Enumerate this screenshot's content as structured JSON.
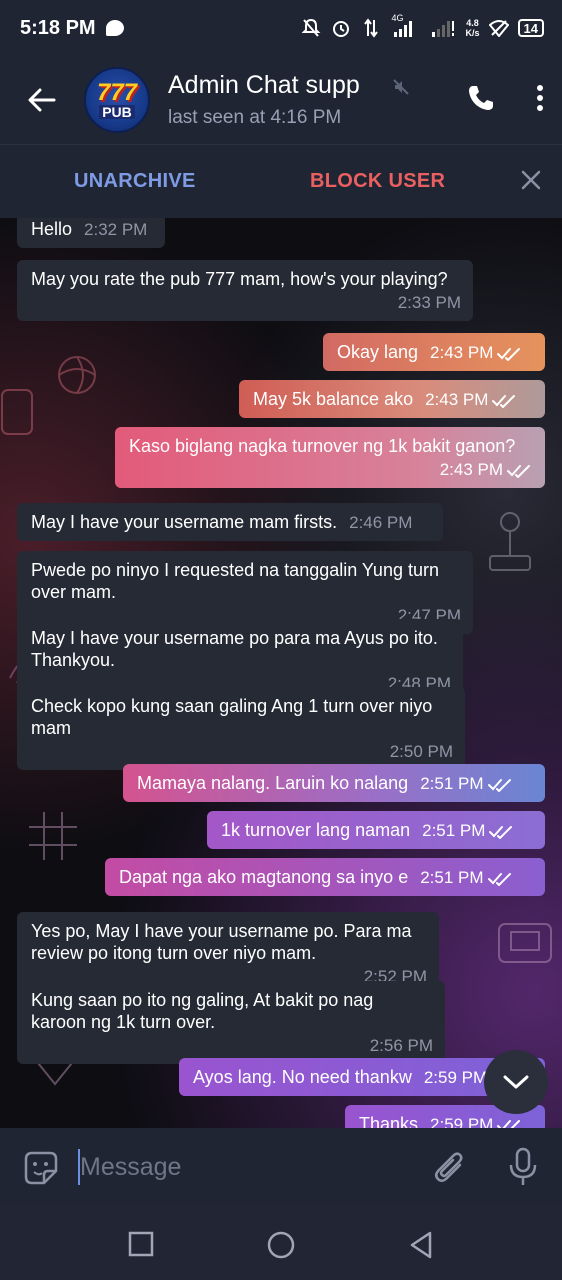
{
  "status_bar": {
    "time": "5:18 PM",
    "network_label": "4G",
    "speed_value": "4.8",
    "speed_unit": "K/s",
    "battery": "14"
  },
  "header": {
    "title": "Admin Chat supp",
    "subtitle": "last seen at 4:16 PM",
    "avatar": {
      "number": "777",
      "label": "PUB"
    }
  },
  "action_bar": {
    "unarchive_label": "UNARCHIVE",
    "block_label": "BLOCK USER"
  },
  "messages": [
    {
      "dir": "in",
      "text": "Hello",
      "time": "2:32 PM"
    },
    {
      "dir": "in",
      "text": "May you rate the pub 777 mam, how's your playing?",
      "time": "2:33 PM"
    },
    {
      "dir": "out",
      "text": "Okay lang",
      "time": "2:43 PM",
      "read": true
    },
    {
      "dir": "out",
      "text": "May 5k balance ako",
      "time": "2:43 PM",
      "read": true
    },
    {
      "dir": "out",
      "text": "Kaso biglang nagka turnover ng 1k bakit ganon?",
      "time": "2:43 PM",
      "read": true
    },
    {
      "dir": "in",
      "text": "May I have your username mam firsts.",
      "time": "2:46 PM"
    },
    {
      "dir": "in",
      "text": "Pwede po ninyo I requested na tanggalin Yung turn over mam.",
      "time": "2:47 PM"
    },
    {
      "dir": "in",
      "text": "May I have your username po para ma Ayus po ito. Thankyou.",
      "time": "2:48 PM"
    },
    {
      "dir": "in",
      "text": "Check kopo kung saan galing Ang 1 turn over niyo mam",
      "time": "2:50 PM"
    },
    {
      "dir": "out",
      "text": "Mamaya nalang. Laruin ko nalang",
      "time": "2:51 PM",
      "read": true
    },
    {
      "dir": "out",
      "text": "1k turnover lang naman",
      "time": "2:51 PM",
      "read": true
    },
    {
      "dir": "out",
      "text": "Dapat nga ako magtanong sa inyo e",
      "time": "2:51 PM",
      "read": true
    },
    {
      "dir": "in",
      "text": "Yes po, May I have your username po. Para ma review po itong turn over niyo mam.",
      "time": "2:52 PM"
    },
    {
      "dir": "in",
      "text": "Kung saan po ito ng galing, At bakit po nag karoon ng 1k turn over.",
      "time": "2:56 PM"
    },
    {
      "dir": "out",
      "text": "Ayos lang. No need thankw",
      "time": "2:59 PM",
      "read": true
    },
    {
      "dir": "out",
      "text": "Thanks",
      "time": "2:59 PM",
      "read": true
    }
  ],
  "input": {
    "placeholder": "Message"
  },
  "colors": {
    "header_bg": "#1f2533",
    "incoming_bubble": "#262a35",
    "unarchive": "#7f9be4",
    "block_user": "#ea6061"
  },
  "icons": [
    "back-arrow-icon",
    "mute-icon",
    "phone-icon",
    "more-vert-icon",
    "close-icon",
    "double-check-icon",
    "chevron-down-icon",
    "sticker-icon",
    "attach-icon",
    "mic-icon",
    "square-nav-icon",
    "circle-nav-icon",
    "triangle-back-nav-icon"
  ]
}
